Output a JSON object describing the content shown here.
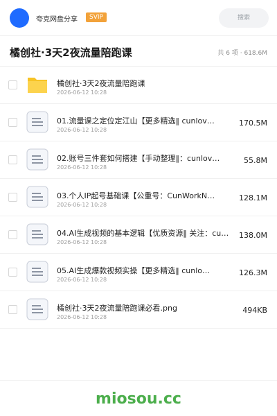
{
  "topbar": {
    "brand": "夸克网盘分享",
    "badge": "SVIP",
    "search_placeholder": "搜索"
  },
  "header": {
    "title": "橘创社·3天2夜流量陪跑课",
    "summary": "共 6 项 · 618.6M"
  },
  "files": [
    {
      "name": "橘创社·3天2夜流量陪跑课",
      "date": "2026-06-12 10:28",
      "size": "",
      "type": "folder-icon"
    },
    {
      "name": "01.流量课之定位定江山【更多精选‖ cunlov…",
      "date": "2026-06-12 10:28",
      "size": "170.5M",
      "type": "file-icon"
    },
    {
      "name": "02.账号三件套如何搭建【手动整理‖：cunlov…",
      "date": "2026-06-12 10:28",
      "size": "55.8M",
      "type": "file-icon"
    },
    {
      "name": "03.个人IP起号基础课【公重号：CunWorkN…",
      "date": "2026-06-12 10:28",
      "size": "128.1M",
      "type": "file-icon"
    },
    {
      "name": "04.AI生成视频的基本逻辑【优质资源‖ 关注：cu…",
      "date": "2026-06-12 10:28",
      "size": "138.0M",
      "type": "file-icon"
    },
    {
      "name": "05.AI生成爆款视频实操【更多精选‖ cunlo…",
      "date": "2026-06-12 10:28",
      "size": "126.3M",
      "type": "file-icon"
    },
    {
      "name": "橘创社·3天2夜流量陪跑课必看.png",
      "date": "2026-06-12 10:28",
      "size": "494KB",
      "type": "file-icon"
    }
  ],
  "footer": {
    "watermark": "miosou.cc"
  },
  "colors": {
    "accent": "#1f6bff",
    "badge": "#f2a23a",
    "folder": "#f7c325",
    "watermark": "#4cae4c"
  }
}
